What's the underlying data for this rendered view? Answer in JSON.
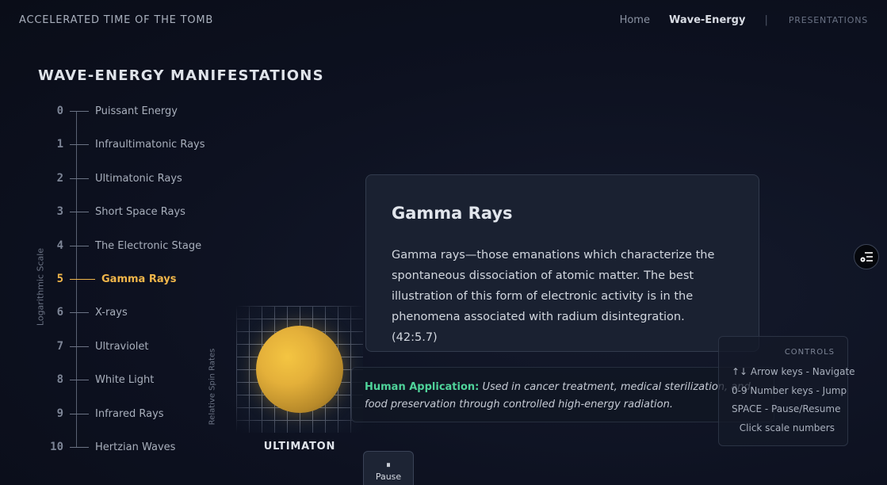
{
  "header": {
    "brand": "ACCELERATED TIME OF THE TOMB",
    "nav": {
      "home": "Home",
      "wave_energy": "Wave-Energy",
      "separator": "|",
      "presentations": "PRESENTATIONS"
    }
  },
  "section": {
    "title": "WAVE-ENERGY MANIFESTATIONS"
  },
  "scale": {
    "axis_label": "Logarithmic Scale",
    "active_index": 5,
    "items": [
      {
        "num": "0",
        "name": "Puissant Energy"
      },
      {
        "num": "1",
        "name": "Infraultimatonic Rays"
      },
      {
        "num": "2",
        "name": "Ultimatonic Rays"
      },
      {
        "num": "3",
        "name": "Short Space Rays"
      },
      {
        "num": "4",
        "name": "The Electronic Stage"
      },
      {
        "num": "5",
        "name": "Gamma Rays"
      },
      {
        "num": "6",
        "name": "X-rays"
      },
      {
        "num": "7",
        "name": "Ultraviolet"
      },
      {
        "num": "8",
        "name": "White Light"
      },
      {
        "num": "9",
        "name": "Infrared Rays"
      },
      {
        "num": "10",
        "name": "Hertzian Waves"
      }
    ]
  },
  "visual": {
    "axis_label": "Relative Spin Rates",
    "particle_label": "ULTIMATON",
    "orb_color": "#e4b03a"
  },
  "card": {
    "title": "Gamma Rays",
    "text": "Gamma rays—those emanations which characterize the spontaneous dissociation of atomic matter. The best illustration of this form of electronic activity is in the phenomena associated with radium disintegration. (42:5.7)"
  },
  "application": {
    "label": "Human Application:",
    "text": "Used in cancer treatment, medical sterilization, and food preservation through controlled high-energy radiation."
  },
  "controls": {
    "title": "CONTROLS",
    "lines": [
      "↑↓ Arrow keys - Navigate",
      "0-9 Number keys - Jump",
      "SPACE - Pause/Resume",
      "Click scale numbers"
    ]
  },
  "pause_button": {
    "symbol": "⏸",
    "label": "Pause"
  },
  "floating_button": {
    "icon": "menu-list-icon"
  },
  "colors": {
    "accent": "#f0b64a",
    "application_label": "#4fd39a",
    "background": "#0d1120"
  }
}
